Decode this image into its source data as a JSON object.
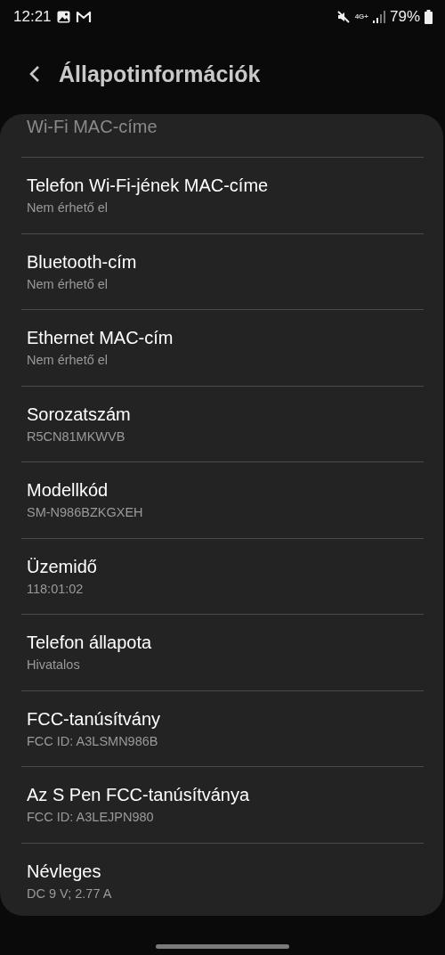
{
  "status_bar": {
    "time": "12:21",
    "network": "4G+",
    "battery": "79%"
  },
  "header": {
    "title": "Állapotinformációk"
  },
  "partial_item": {
    "title": "Wi-Fi MAC-címe"
  },
  "items": [
    {
      "title": "Telefon Wi-Fi-jének MAC-címe",
      "value": "Nem érhető el"
    },
    {
      "title": "Bluetooth-cím",
      "value": "Nem érhető el"
    },
    {
      "title": "Ethernet MAC-cím",
      "value": "Nem érhető el"
    },
    {
      "title": "Sorozatszám",
      "value": "R5CN81MKWVB"
    },
    {
      "title": "Modellkód",
      "value": "SM-N986BZKGXEH"
    },
    {
      "title": "Üzemidő",
      "value": "118:01:02"
    },
    {
      "title": "Telefon állapota",
      "value": "Hivatalos"
    },
    {
      "title": "FCC-tanúsítvány",
      "value": "FCC ID: A3LSMN986B"
    },
    {
      "title": "Az S Pen FCC-tanúsítványa",
      "value": "FCC ID: A3LEJPN980"
    },
    {
      "title": "Névleges",
      "value": "DC 9 V; 2.77 A"
    }
  ]
}
